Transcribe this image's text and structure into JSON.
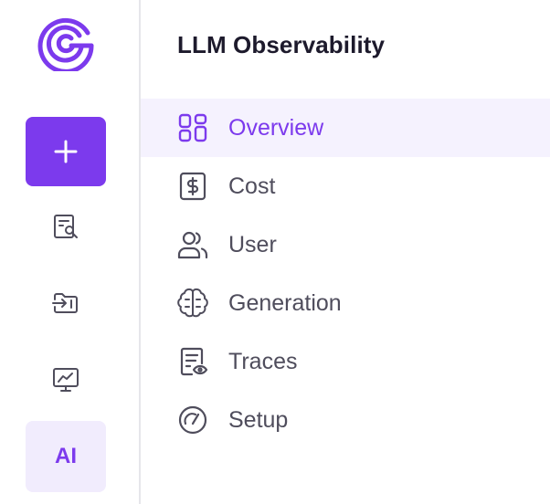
{
  "rail": {
    "logo": "brand-logo",
    "add_label": "+",
    "icons": [
      "report-search-icon",
      "folder-import-icon",
      "monitor-chart-icon"
    ],
    "ai_label": "AI"
  },
  "panel": {
    "title": "LLM Observability",
    "items": [
      {
        "label": "Overview",
        "icon": "grid-icon",
        "active": true
      },
      {
        "label": "Cost",
        "icon": "dollar-icon",
        "active": false
      },
      {
        "label": "User",
        "icon": "users-icon",
        "active": false
      },
      {
        "label": "Generation",
        "icon": "brain-icon",
        "active": false
      },
      {
        "label": "Traces",
        "icon": "trace-doc-icon",
        "active": false
      },
      {
        "label": "Setup",
        "icon": "gauge-icon",
        "active": false
      }
    ]
  },
  "colors": {
    "accent": "#7c3aed",
    "active_bg": "#f5f2fe",
    "ai_bg": "#f1ecfd",
    "text": "#4f4d5c",
    "title": "#1d1a2c",
    "border": "#e6e6ea"
  }
}
